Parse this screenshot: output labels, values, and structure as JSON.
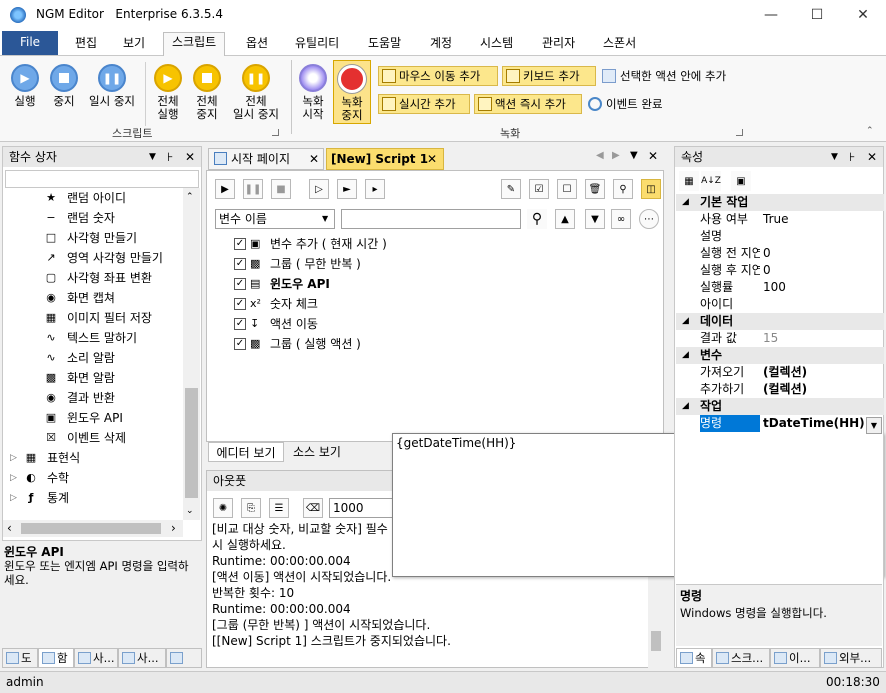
{
  "app": {
    "title": "NGM Editor",
    "edition": "Enterprise 6.3.5.4"
  },
  "menu": [
    "File",
    "편집",
    "보기",
    "스크립트",
    "옵션",
    "유틸리티",
    "도움말",
    "계정",
    "시스템",
    "관리자",
    "스폰서"
  ],
  "ribbon": {
    "script_group": "스크립트",
    "record_group": "녹화",
    "buttons": {
      "run": "실행",
      "stop": "중지",
      "pause": "일시 중지",
      "run_all": "전체\n실행",
      "stop_all": "전체\n중지",
      "pause_all": "전체\n일시 중지",
      "rec_start": "녹화\n시작",
      "rec_stop": "녹화\n중지"
    },
    "actions": {
      "mouse": "마우스 이동 추가",
      "keyboard": "키보드 추가",
      "inside": "선택한 액션 안에 추가",
      "realtime": "실시간 추가",
      "instant": "액션 즉시 추가",
      "finish": "이벤트 완료"
    }
  },
  "left": {
    "title": "함수 상자",
    "items": [
      "랜덤 아이디",
      "랜덤 숫자",
      "사각형 만들기",
      "영역 사각형 만들기",
      "사각형 좌표 변환",
      "화면 캡쳐",
      "이미지 필터 저장",
      "텍스트 말하기",
      "소리 알람",
      "화면 알람",
      "결과 반환",
      "윈도우 API",
      "이벤트 삭제"
    ],
    "groups": [
      "표현식",
      "수학",
      "통계"
    ],
    "desc_title": "윈도우 API",
    "desc_text": "윈도우 또는 엔지엠 API 명령을 입력하세요.",
    "tabs": [
      "도",
      "함",
      "사...",
      "사...",
      ""
    ]
  },
  "center": {
    "tabs": [
      "시작 페이지",
      "[New] Script 1"
    ],
    "var_select": "변수 이름",
    "search_placeholder": "",
    "lines": [
      "변수 추가 ( 현재 시간 )",
      "그룹 ( 무한 반복 )",
      "윈도우 API",
      "숫자 체크",
      "액션 이동",
      "그룹 ( 실행 액션 )"
    ],
    "view_tabs": [
      "에디터 보기",
      "소스 보기"
    ]
  },
  "output": {
    "title": "아웃풋",
    "count": "1000",
    "lines": [
      "[비교 대상 숫자, 비교할 숫자] 필수",
      "시 실행하세요.",
      "Runtime: 00:00:00.004",
      "[액션 이동] 액션이 시작되었습니다.",
      "반복한 횟수: 10",
      "Runtime: 00:00:00.004",
      "[그룹 (무한 반복) ] 액션이 시작되었습니다.",
      "[[New] Script 1] 스크립트가 중지되었습니다."
    ]
  },
  "popup": {
    "text": "{getDateTime(HH)}"
  },
  "props": {
    "title": "속성",
    "cats": [
      "기본 작업",
      "데이터",
      "변수",
      "작업"
    ],
    "basic": [
      [
        "사용 여부",
        "True"
      ],
      [
        "설명",
        ""
      ],
      [
        "실행 전 지연",
        "0"
      ],
      [
        "실행 후 지연",
        "0"
      ],
      [
        "실행률",
        "100"
      ],
      [
        "아이디",
        ""
      ]
    ],
    "data": [
      [
        "결과 값",
        "15"
      ]
    ],
    "vars": [
      [
        "가져오기",
        "(컬렉션)"
      ],
      [
        "추가하기",
        "(컬렉션)"
      ]
    ],
    "work": [
      [
        "명령",
        "tDateTime(HH)}"
      ]
    ],
    "desc_title": "명령",
    "desc_text": "Windows 명령을 실행합니다.",
    "tabs": [
      "속",
      "스크...",
      "이...",
      "외부..."
    ]
  },
  "status": {
    "user": "admin",
    "time": "00:18:30"
  }
}
